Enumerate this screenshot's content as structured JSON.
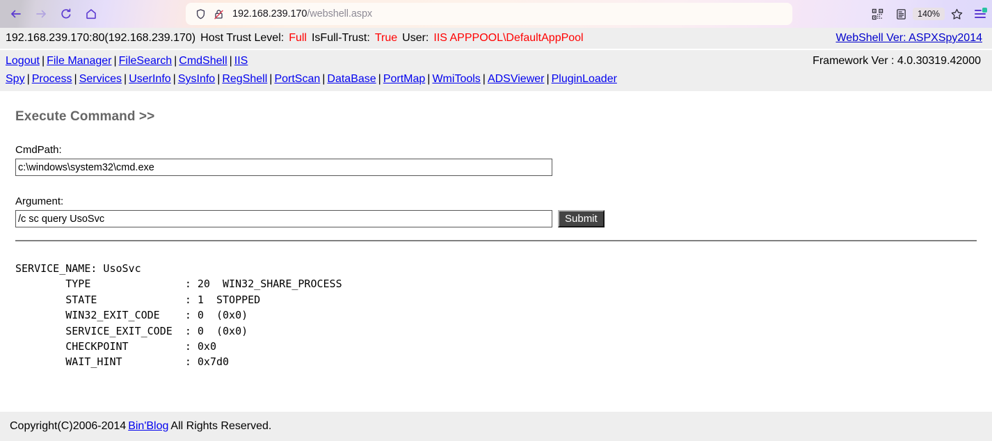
{
  "browser": {
    "back_icon": "arrow-left-icon",
    "forward_icon": "arrow-right-icon",
    "reload_icon": "reload-icon",
    "home_icon": "home-icon",
    "shield_icon": "shield-icon",
    "insecure_icon": "lock-crossed-icon",
    "url_host": "192.168.239.170",
    "url_path": "/webshell.aspx",
    "qr_icon": "qr-code-icon",
    "reader_icon": "reader-view-icon",
    "zoom_level": "140%",
    "bookmark_icon": "star-icon",
    "menu_icon": "hamburger-menu-icon"
  },
  "status": {
    "host": "192.168.239.170:80(192.168.239.170)",
    "trust_label": "Host Trust Level:",
    "trust_value": "Full",
    "isfull_label": "IsFull-Trust:",
    "isfull_value": "True",
    "user_label": "User:",
    "user_value": "IIS APPPOOL\\DefaultAppPool",
    "version_link": "WebShell Ver: ASPXSpy2014"
  },
  "nav": {
    "items": [
      "Logout",
      "File Manager",
      "FileSearch",
      "CmdShell",
      "IIS Spy",
      "Process",
      "Services",
      "UserInfo",
      "SysInfo",
      "RegShell",
      "PortScan",
      "DataBase",
      "PortMap",
      "WmiTools",
      "ADSViewer",
      "PluginLoader"
    ],
    "framework": "Framework Ver : 4.0.30319.42000"
  },
  "main": {
    "title": "Execute Command >>",
    "cmdpath_label": "CmdPath:",
    "cmdpath_value": "c:\\windows\\system32\\cmd.exe",
    "cmdpath_placeholder": "",
    "argument_label": "Argument:",
    "argument_value": "/c sc query UsoSvc",
    "argument_placeholder": "",
    "submit_label": "Submit",
    "output": "SERVICE_NAME: UsoSvc\n        TYPE               : 20  WIN32_SHARE_PROCESS\n        STATE              : 1  STOPPED\n        WIN32_EXIT_CODE    : 0  (0x0)\n        SERVICE_EXIT_CODE  : 0  (0x0)\n        CHECKPOINT         : 0x0\n        WAIT_HINT          : 0x7d0"
  },
  "footer": {
    "copyright_prefix": "Copyright(C)2006-2014",
    "blog_link": "Bin'Blog",
    "copyright_suffix": "All Rights Reserved."
  },
  "colors": {
    "link": "#0000ee",
    "red_value": "#ff0000",
    "title_gray": "#666666",
    "bar_bg": "#eeeeee",
    "submit_bg": "#444444"
  }
}
